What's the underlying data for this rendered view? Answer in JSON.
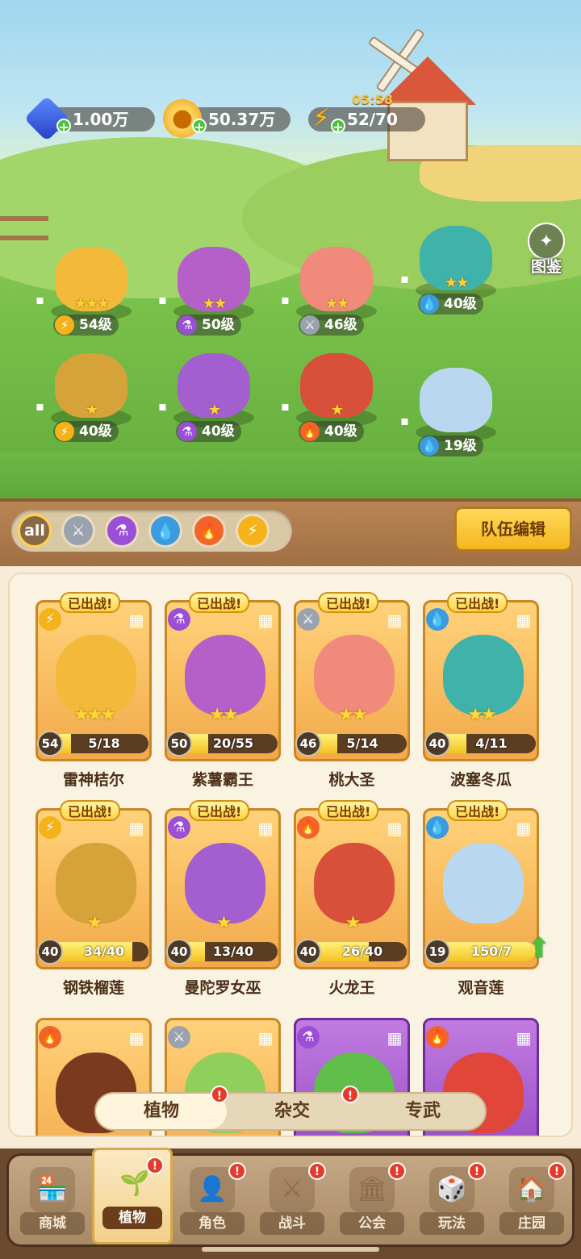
{
  "resources": {
    "gems": "1.00万",
    "gold": "50.37万",
    "energy": "52/70",
    "energy_timer": "05:58"
  },
  "atlas_label": "图鉴",
  "team": [
    {
      "name": "雷神桔尔",
      "level": "54级",
      "element": "lightning",
      "stars": "★★★"
    },
    {
      "name": "紫薯霸王",
      "level": "50级",
      "element": "poison",
      "stars": "★★"
    },
    {
      "name": "桃大圣",
      "level": "46级",
      "element": "sword",
      "stars": "★★"
    },
    {
      "name": "波塞冬瓜",
      "level": "40级",
      "element": "water",
      "stars": "★★"
    },
    {
      "name": "钢铁榴莲",
      "level": "40级",
      "element": "lightning",
      "stars": "★"
    },
    {
      "name": "曼陀罗女巫",
      "level": "40级",
      "element": "poison",
      "stars": "★"
    },
    {
      "name": "火龙王",
      "level": "40级",
      "element": "fire",
      "stars": "★"
    },
    {
      "name": "观音莲",
      "level": "19级",
      "element": "water",
      "stars": ""
    }
  ],
  "filters": {
    "all": "all",
    "items": [
      "sword-filter",
      "poison-filter",
      "water-filter",
      "fire-filter",
      "lightning-filter"
    ]
  },
  "team_edit_label": "队伍编辑",
  "deploy_label": "已出战!",
  "cards": [
    {
      "name": "雷神桔尔",
      "level": "54",
      "progress": "5/18",
      "ratio": 0.28,
      "stars": "★★★",
      "element": "lightning"
    },
    {
      "name": "紫薯霸王",
      "level": "50",
      "progress": "20/55",
      "ratio": 0.36,
      "stars": "★★",
      "element": "poison"
    },
    {
      "name": "桃大圣",
      "level": "46",
      "progress": "5/14",
      "ratio": 0.36,
      "stars": "★★",
      "element": "sword"
    },
    {
      "name": "波塞冬瓜",
      "level": "40",
      "progress": "4/11",
      "ratio": 0.36,
      "stars": "★★",
      "element": "water"
    },
    {
      "name": "钢铁榴莲",
      "level": "40",
      "progress": "34/40",
      "ratio": 0.85,
      "stars": "★",
      "element": "lightning"
    },
    {
      "name": "曼陀罗女巫",
      "level": "40",
      "progress": "13/40",
      "ratio": 0.33,
      "stars": "★",
      "element": "poison"
    },
    {
      "name": "火龙王",
      "level": "40",
      "progress": "26/40",
      "ratio": 0.65,
      "stars": "★",
      "element": "fire"
    },
    {
      "name": "观音莲",
      "level": "19",
      "progress": "150/7",
      "ratio": 1.0,
      "stars": "",
      "element": "water"
    }
  ],
  "segments": [
    "植物",
    "杂交",
    "专武"
  ],
  "nav": [
    {
      "label": "商城",
      "icon": "shop-icon"
    },
    {
      "label": "植物",
      "icon": "plants-icon"
    },
    {
      "label": "角色",
      "icon": "character-icon"
    },
    {
      "label": "战斗",
      "icon": "battle-icon"
    },
    {
      "label": "公会",
      "icon": "guild-icon"
    },
    {
      "label": "玩法",
      "icon": "gameplay-icon"
    },
    {
      "label": "庄园",
      "icon": "manor-icon"
    }
  ],
  "badge": "!",
  "colors": {
    "lightning": "#f5b21a",
    "poison": "#9b4fd6",
    "sword": "#9aa3ad",
    "water": "#3a9be0",
    "fire": "#f2642a"
  }
}
